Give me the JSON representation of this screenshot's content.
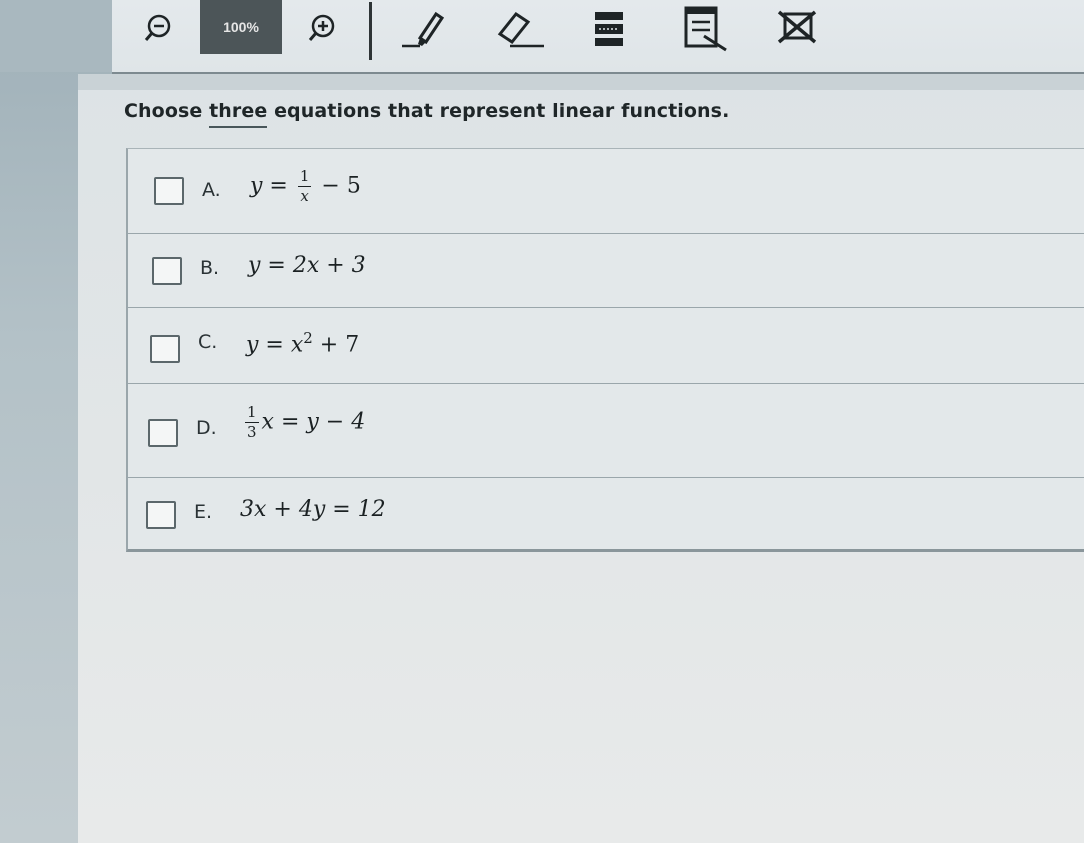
{
  "toolbar": {
    "zoom_out_icon": "zoom-out-icon",
    "zoom_level": "100%",
    "zoom_in_icon": "zoom-in-icon",
    "tools": [
      "highlighter-icon",
      "eraser-icon",
      "line-reader-icon",
      "notepad-icon",
      "answer-eliminator-icon"
    ]
  },
  "question": {
    "before": "Choose ",
    "emphasis": "three",
    "after": " equations that represent linear functions."
  },
  "choices": [
    {
      "letter": "A.",
      "equation": "y = 1/x − 5",
      "checked": false
    },
    {
      "letter": "B.",
      "equation": "y = 2x + 3",
      "checked": false
    },
    {
      "letter": "C.",
      "equation": "y = x^2 + 7",
      "checked": false
    },
    {
      "letter": "D.",
      "equation": "1/3x = y − 4",
      "checked": false
    },
    {
      "letter": "E.",
      "equation": "3x + 4y = 12",
      "checked": false
    }
  ],
  "eq_parts": {
    "a_lhs": "y =",
    "a_num": "1",
    "a_den": "x",
    "a_rhs": "− 5",
    "b": "y = 2x + 3",
    "c_lhs": "y = x",
    "c_sup": "2",
    "c_rhs": " + 7",
    "d_num": "1",
    "d_den": "3",
    "d_rhs": "x = y − 4",
    "e": "3x + 4y = 12"
  }
}
